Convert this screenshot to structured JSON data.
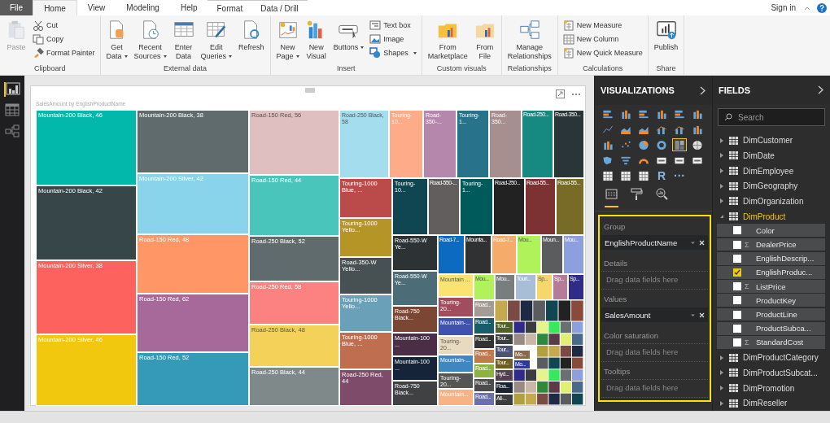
{
  "ribbon_tabs": [
    {
      "label": "File",
      "kind": "file",
      "selected": false
    },
    {
      "label": "Home",
      "kind": "tab",
      "selected": true
    },
    {
      "label": "View",
      "kind": "tab",
      "selected": false
    },
    {
      "label": "Modeling",
      "kind": "tab",
      "selected": false
    },
    {
      "label": "Help",
      "kind": "tab",
      "selected": false
    },
    {
      "label": "Format",
      "kind": "contextual",
      "selected": false
    },
    {
      "label": "Data / Drill",
      "kind": "contextual",
      "selected": false
    }
  ],
  "account": {
    "sign_in": "Sign in"
  },
  "ribbon_groups": [
    {
      "label": "Clipboard",
      "items": [
        {
          "kind": "large",
          "lines": [
            "Paste"
          ],
          "dropdown": false,
          "disabled": true
        },
        {
          "kind": "small",
          "lines": [
            "Cut"
          ],
          "dropdown": false,
          "disabled": false
        },
        {
          "kind": "small",
          "lines": [
            "Copy"
          ],
          "dropdown": false,
          "disabled": false
        },
        {
          "kind": "small",
          "lines": [
            "Format Painter"
          ],
          "dropdown": false,
          "disabled": false
        }
      ]
    },
    {
      "label": "External data",
      "items": [
        {
          "kind": "large",
          "lines": [
            "Get",
            "Data"
          ],
          "dropdown": true,
          "disabled": false
        },
        {
          "kind": "large",
          "lines": [
            "Recent",
            "Sources"
          ],
          "dropdown": true,
          "disabled": false
        },
        {
          "kind": "large",
          "lines": [
            "Enter",
            "Data"
          ],
          "dropdown": false,
          "disabled": false
        },
        {
          "kind": "large",
          "lines": [
            "Edit",
            "Queries"
          ],
          "dropdown": true,
          "disabled": false
        },
        {
          "kind": "large",
          "lines": [
            "Refresh"
          ],
          "dropdown": false,
          "disabled": false
        }
      ]
    },
    {
      "label": "Insert",
      "items": [
        {
          "kind": "large",
          "lines": [
            "New",
            "Page"
          ],
          "dropdown": true,
          "disabled": false
        },
        {
          "kind": "large",
          "lines": [
            "New",
            "Visual"
          ],
          "dropdown": false,
          "disabled": false
        },
        {
          "kind": "large",
          "lines": [
            "Buttons"
          ],
          "dropdown": true,
          "disabled": false
        },
        {
          "kind": "small",
          "lines": [
            "Text box"
          ],
          "dropdown": false,
          "disabled": false
        },
        {
          "kind": "small",
          "lines": [
            "Image"
          ],
          "dropdown": false,
          "disabled": false
        },
        {
          "kind": "small",
          "lines": [
            "Shapes"
          ],
          "dropdown": true,
          "disabled": false
        }
      ]
    },
    {
      "label": "Custom visuals",
      "items": [
        {
          "kind": "large",
          "lines": [
            "From",
            "Marketplace"
          ],
          "dropdown": false,
          "disabled": false
        },
        {
          "kind": "large",
          "lines": [
            "From",
            "File"
          ],
          "dropdown": false,
          "disabled": false
        }
      ]
    },
    {
      "label": "Relationships",
      "items": [
        {
          "kind": "large",
          "lines": [
            "Manage",
            "Relationships"
          ],
          "dropdown": false,
          "disabled": false
        }
      ]
    },
    {
      "label": "Calculations",
      "items": [
        {
          "kind": "small",
          "lines": [
            "New Measure"
          ],
          "dropdown": false,
          "disabled": false
        },
        {
          "kind": "small",
          "lines": [
            "New Column"
          ],
          "dropdown": false,
          "disabled": false
        },
        {
          "kind": "small",
          "lines": [
            "New Quick Measure"
          ],
          "dropdown": false,
          "disabled": false
        }
      ]
    },
    {
      "label": "Share",
      "items": [
        {
          "kind": "large",
          "lines": [
            "Publish"
          ],
          "dropdown": false,
          "disabled": false
        }
      ]
    }
  ],
  "views": [
    {
      "kind": "report",
      "selected": true
    },
    {
      "kind": "data",
      "selected": false
    },
    {
      "kind": "model",
      "selected": false
    }
  ],
  "visual_card": {
    "title": "SalesAmount by EnglishProductName",
    "tiles": [
      {
        "label": "Mountain-200 Black, 46",
        "color": "#01b8aa"
      },
      {
        "label": "Mountain-200 Black, 42",
        "color": "#374649"
      },
      {
        "label": "Mountain-200 Silver, 38",
        "color": "#fd625e"
      },
      {
        "label": "Mountain-200 Silver, 46",
        "color": "#f2c80f"
      },
      {
        "label": "Mountain-200 Black, 38",
        "color": "#5f6b6d"
      },
      {
        "label": "Mountain-200 Silver, 42",
        "color": "#8ad4eb"
      },
      {
        "label": "Road-150 Red, 48",
        "color": "#fe9666"
      },
      {
        "label": "Road-150 Red, 62",
        "color": "#a66999"
      },
      {
        "label": "Road-150 Red, 52",
        "color": "#3599b8"
      },
      {
        "label": "Road-150 Red, 56",
        "color": "#dfbfbf"
      },
      {
        "label": "Road-150 Red, 44",
        "color": "#4ac5bb"
      },
      {
        "label": "Road-250 Black, 52",
        "color": "#5f6b6d"
      },
      {
        "label": "Road-250 Red, 58",
        "color": "#fb8281"
      },
      {
        "label": "Road-250 Black, 48",
        "color": "#f4d25a"
      },
      {
        "label": "Road-250 Black, 44",
        "color": "#7f898a"
      },
      {
        "label": "Road-250 Black, 58",
        "color": "#a4ddee"
      },
      {
        "label": "Touring-10...",
        "color": "#fdab89"
      },
      {
        "label": "Road-350-...",
        "color": "#b687ac"
      },
      {
        "label": "Touring-1...",
        "color": "#28738a"
      },
      {
        "label": "Road-350...",
        "color": "#a78f8f"
      },
      {
        "label": "Road-250...",
        "color": "#168980"
      },
      {
        "label": "Road-350...",
        "color": "#293537"
      },
      {
        "label": "Touring-1000 Blue, ...",
        "color": "#bb4a4a"
      },
      {
        "label": "Touring-1000 Yello...",
        "color": "#b59525"
      },
      {
        "label": "Road-350-W Yello...",
        "color": "#475052"
      },
      {
        "label": "Touring-1000 Yello...",
        "color": "#6aa0b8"
      },
      {
        "label": "Touring-1000 Blue, ...",
        "color": "#c06e50"
      },
      {
        "label": "Road-250 Red, 44",
        "color": "#7e4c6a"
      },
      {
        "label": "Touring-10...",
        "color": "#0f4651"
      },
      {
        "label": "Road-550-...",
        "color": "#625e5e"
      },
      {
        "label": "Touring-1...",
        "color": "#005a5c"
      },
      {
        "label": "Road-250...",
        "color": "#222222"
      },
      {
        "label": "Road-55...",
        "color": "#7c3232"
      },
      {
        "label": "Road-55...",
        "color": "#776b27"
      },
      {
        "label": "Road-550-W Ye...",
        "color": "#2d3235"
      },
      {
        "label": "Road-550-W Ye...",
        "color": "#4c6c78"
      },
      {
        "label": "Road-750 Black...",
        "color": "#7b4634"
      },
      {
        "label": "Mountain-100 ...",
        "color": "#4a2e46"
      },
      {
        "label": "Mountain-100 ...",
        "color": "#16243a"
      },
      {
        "label": "Road-750 Black...",
        "color": "#3f4143"
      },
      {
        "label": "Road-7...",
        "color": "#0c6bc0"
      },
      {
        "label": "Mounta...",
        "color": "#2f3133"
      },
      {
        "label": "Road-7...",
        "color": "#f5ac6a"
      },
      {
        "label": "Mou...",
        "color": "#aff259"
      },
      {
        "label": "Moun...",
        "color": "#5b5c5e"
      },
      {
        "label": "Mou...",
        "color": "#8c9fdf"
      },
      {
        "label": "Mountain ...",
        "color": "#fbe372"
      },
      {
        "label": "Touring-20...",
        "color": "#a14d5e"
      },
      {
        "label": "Mountain-...",
        "color": "#3f52b0"
      },
      {
        "label": "Touring-20...",
        "color": "#e8dac0"
      },
      {
        "label": "Mountain-...",
        "color": "#3e87c0"
      },
      {
        "label": "Touring-20...",
        "color": "#545656"
      },
      {
        "label": "Mountain...",
        "color": "#f9b284"
      },
      {
        "label": "Mou...",
        "color": "#aff259"
      },
      {
        "label": "Road...",
        "color": "#a49b96"
      },
      {
        "label": "Road...",
        "color": "#175d6c"
      },
      {
        "label": "Road...",
        "color": "#333333"
      },
      {
        "label": "Road...",
        "color": "#c07a4c"
      },
      {
        "label": "Road...",
        "color": "#8cb33f"
      },
      {
        "label": "Road...",
        "color": "#4c4c4c"
      },
      {
        "label": "Road...",
        "color": "#6b6fb0"
      },
      {
        "label": "Mou...",
        "color": "#787e80"
      },
      {
        "label": "Touri...",
        "color": "#a8bed6"
      },
      {
        "label": "Sp...",
        "color": "#f5d76a"
      },
      {
        "label": "Sp...",
        "color": "#b57c98"
      },
      {
        "label": "Sp...",
        "color": "#2e2c88"
      },
      {
        "label": "Tour...",
        "color": "#506129"
      },
      {
        "label": "Tour...",
        "color": "#3b3f41"
      },
      {
        "label": "Tour...",
        "color": "#4e5374"
      },
      {
        "label": "Tour...",
        "color": "#6d5e24"
      },
      {
        "label": "Hyd...",
        "color": "#533f4f"
      },
      {
        "label": "Roa...",
        "color": "#1a2331"
      },
      {
        "label": "All-...",
        "color": "#3a3c3e"
      },
      {
        "label": "Mo...",
        "color": "#8a6a4a"
      },
      {
        "label": "Mo...",
        "color": "#2e3a9a"
      }
    ]
  },
  "visualizations": {
    "title": "VISUALIZATIONS",
    "visuals": [
      {
        "kind": "hbar",
        "selected": false
      },
      {
        "kind": "col",
        "selected": false
      },
      {
        "kind": "hbar",
        "selected": false
      },
      {
        "kind": "col",
        "selected": false
      },
      {
        "kind": "hbar",
        "selected": false
      },
      {
        "kind": "col",
        "selected": false
      },
      {
        "kind": "line",
        "selected": false
      },
      {
        "kind": "area",
        "selected": false
      },
      {
        "kind": "area",
        "selected": false
      },
      {
        "kind": "combo",
        "selected": false
      },
      {
        "kind": "combo",
        "selected": false
      },
      {
        "kind": "col",
        "selected": false
      },
      {
        "kind": "col",
        "selected": false
      },
      {
        "kind": "scatter",
        "selected": false
      },
      {
        "kind": "pie",
        "selected": false
      },
      {
        "kind": "donut",
        "selected": false
      },
      {
        "kind": "treemap",
        "selected": true
      },
      {
        "kind": "globe",
        "selected": false
      },
      {
        "kind": "map",
        "selected": false
      },
      {
        "kind": "funnel",
        "selected": false
      },
      {
        "kind": "gauge",
        "selected": false
      },
      {
        "kind": "card",
        "selected": false
      },
      {
        "kind": "card",
        "selected": false
      },
      {
        "kind": "card",
        "selected": false
      },
      {
        "kind": "table",
        "selected": false
      },
      {
        "kind": "table",
        "selected": false
      },
      {
        "kind": "table",
        "selected": false
      },
      {
        "kind": "glyph",
        "glyph": "R",
        "selected": false
      },
      {
        "kind": "glyph",
        "glyph": "···",
        "selected": false
      }
    ],
    "pane_tabs": [
      {
        "kind": "fields",
        "selected": true
      },
      {
        "kind": "format",
        "selected": false
      },
      {
        "kind": "analytics",
        "selected": false
      }
    ],
    "wells": [
      {
        "label": "Group",
        "field": "EnglishProductName"
      },
      {
        "label": "Details",
        "placeholder": "Drag data fields here"
      },
      {
        "label": "Values",
        "field": "SalesAmount"
      },
      {
        "label": "Color saturation",
        "placeholder": "Drag data fields here"
      },
      {
        "label": "Tooltips",
        "placeholder": "Drag data fields here"
      }
    ]
  },
  "fields": {
    "title": "FIELDS",
    "search": {
      "placeholder": "Search"
    },
    "tables": [
      {
        "name": "DimCustomer",
        "expanded": false,
        "highlighted": false
      },
      {
        "name": "DimDate",
        "expanded": false,
        "highlighted": false
      },
      {
        "name": "DimEmployee",
        "expanded": false,
        "highlighted": false
      },
      {
        "name": "DimGeography",
        "expanded": false,
        "highlighted": false
      },
      {
        "name": "DimOrganization",
        "expanded": false,
        "highlighted": false
      },
      {
        "name": "DimProduct",
        "expanded": true,
        "highlighted": true,
        "children": [
          {
            "name": "Color",
            "checked": false
          },
          {
            "name": "DealerPrice",
            "sigma": "Σ",
            "checked": false
          },
          {
            "name": "EnglishDescrip...",
            "checked": false
          },
          {
            "name": "EnglishProduc...",
            "checked": true
          },
          {
            "name": "ListPrice",
            "sigma": "Σ",
            "checked": false
          },
          {
            "name": "ProductKey",
            "checked": false
          },
          {
            "name": "ProductLine",
            "checked": false
          },
          {
            "name": "ProductSubca...",
            "checked": false
          },
          {
            "name": "StandardCost",
            "sigma": "Σ",
            "checked": false
          }
        ]
      },
      {
        "name": "DimProductCategory",
        "expanded": false,
        "highlighted": false
      },
      {
        "name": "DimProductSubcat...",
        "expanded": false,
        "highlighted": false
      },
      {
        "name": "DimPromotion",
        "expanded": false,
        "highlighted": false
      },
      {
        "name": "DimReseller",
        "expanded": false,
        "highlighted": false
      }
    ]
  }
}
